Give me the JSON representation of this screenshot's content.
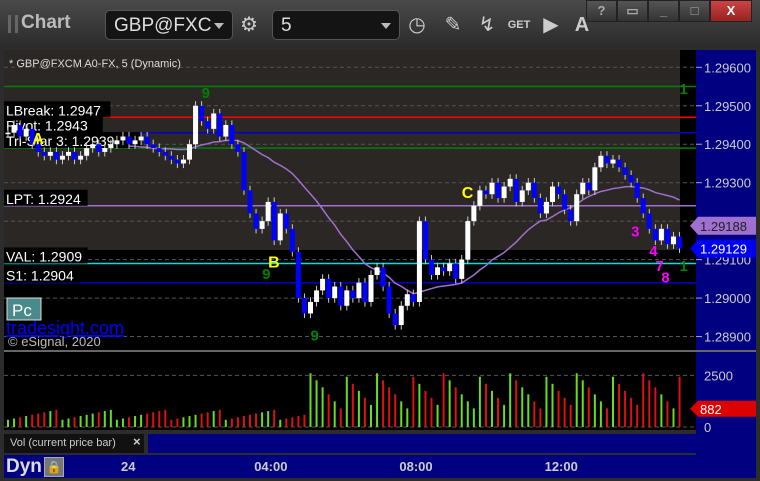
{
  "window": {
    "title": "Chart",
    "symbol": "GBP@FXC",
    "interval": "5",
    "buttons": [
      "?",
      "restore",
      "minimize",
      "maximize",
      "X"
    ]
  },
  "toolbar": {
    "icons": [
      "settings-gear-icon",
      "clock-icon",
      "pencil-icon",
      "study-icon",
      "get-icon",
      "play-icon",
      "alert-icon"
    ],
    "get_label": "GET",
    "alert_label": "A"
  },
  "chart": {
    "header": "* GBP@FXCM A0-FX, 5 (Dynamic)",
    "watermark": "tradesight.com",
    "copyright": "© eSignal, 2020",
    "pc_button": "Pc",
    "price_ticks": [
      "1.29600",
      "1.29500",
      "1.29400",
      "1.29300",
      "1.29200",
      "1.29100",
      "1.29000",
      "1.28900"
    ],
    "price_tick_values": [
      1.296,
      1.295,
      1.294,
      1.293,
      1.292,
      1.291,
      1.29,
      1.289
    ],
    "ylim": [
      1.28865,
      1.29645
    ],
    "ma_marker": "1.29188",
    "last_price": "1.29129",
    "levels": [
      {
        "label": "",
        "value": 1.2955,
        "color": "#008000"
      },
      {
        "label": "LBreak: 1.2947",
        "value": 1.2947,
        "color": "#ff0000"
      },
      {
        "label": "Pivot: 1.2943",
        "value": 1.2943,
        "color": "#0000cc"
      },
      {
        "label": "Tri-Star 3: 1.2939",
        "value": 1.2939,
        "color": "#008000"
      },
      {
        "label": "LPT: 1.2924",
        "value": 1.2924,
        "color": "#a070d0"
      },
      {
        "label": "VAL: 1.2909",
        "value": 1.2909,
        "color": "#00e0e0"
      },
      {
        "label": "S1: 1.2904",
        "value": 1.2904,
        "color": "#0000cc"
      }
    ],
    "annotations": [
      {
        "text": "A",
        "value": 1.294,
        "bar": 4
      },
      {
        "text": "B",
        "value": 1.2908,
        "bar": 43
      },
      {
        "text": "C",
        "value": 1.2926,
        "bar": 75
      }
    ],
    "count_labels": [
      {
        "text": "1",
        "value": 1.2953,
        "bar": 111,
        "color": "#008000"
      },
      {
        "text": "1",
        "value": 1.2907,
        "bar": 111,
        "color": "#008000"
      },
      {
        "text": "9",
        "value": 1.2952,
        "bar": 32,
        "color": "#008000"
      },
      {
        "text": "9",
        "value": 1.2905,
        "bar": 42,
        "color": "#008000"
      },
      {
        "text": "9",
        "value": 1.2889,
        "bar": 50,
        "color": "#008000"
      },
      {
        "text": "3",
        "value": 1.2916,
        "bar": 103,
        "color": "#ff00ff"
      },
      {
        "text": "4",
        "value": 1.2911,
        "bar": 106,
        "color": "#ff00ff"
      },
      {
        "text": "7",
        "value": 1.2907,
        "bar": 107,
        "color": "#ff00ff"
      },
      {
        "text": "8",
        "value": 1.2904,
        "bar": 108,
        "color": "#ff00ff"
      }
    ],
    "closes": [
      1.2943,
      1.2945,
      1.2942,
      1.2944,
      1.294,
      1.2938,
      1.2937,
      1.2938,
      1.2936,
      1.2937,
      1.2938,
      1.2936,
      1.2937,
      1.2939,
      1.294,
      1.2938,
      1.2939,
      1.294,
      1.2941,
      1.2942,
      1.294,
      1.2941,
      1.2942,
      1.294,
      1.2939,
      1.2938,
      1.2937,
      1.2936,
      1.2935,
      1.2936,
      1.294,
      1.295,
      1.2946,
      1.2944,
      1.2948,
      1.2942,
      1.2945,
      1.294,
      1.2938,
      1.2928,
      1.2922,
      1.2918,
      1.292,
      1.2925,
      1.2915,
      1.2922,
      1.2918,
      1.2912,
      1.29,
      1.2896,
      1.2899,
      1.2902,
      1.2905,
      1.29,
      1.2903,
      1.2898,
      1.2902,
      1.29,
      1.2904,
      1.2899,
      1.2906,
      1.2908,
      1.2903,
      1.2896,
      1.2893,
      1.2898,
      1.2901,
      1.2899,
      1.292,
      1.291,
      1.2906,
      1.2908,
      1.2907,
      1.2909,
      1.2905,
      1.291,
      1.292,
      1.2924,
      1.2928,
      1.2927,
      1.293,
      1.2926,
      1.2929,
      1.2931,
      1.2925,
      1.2928,
      1.293,
      1.2926,
      1.2922,
      1.2925,
      1.2929,
      1.2927,
      1.2923,
      1.292,
      1.2927,
      1.293,
      1.2928,
      1.2934,
      1.2937,
      1.2935,
      1.2936,
      1.2934,
      1.2932,
      1.293,
      1.2926,
      1.2922,
      1.2918,
      1.2915,
      1.2918,
      1.2914,
      1.2916,
      1.29129
    ],
    "colors": {
      "up": "#ffffff",
      "down": "#0000ff",
      "ma": "#a070d0",
      "vol_up": "#66dd22",
      "vol_down": "#dd1111",
      "axis_bg": "#000080"
    }
  },
  "volume": {
    "ticks": [
      "2500",
      "0"
    ],
    "tick_values": [
      2500,
      0
    ],
    "ylim": [
      0,
      3000
    ],
    "last": "882",
    "legend": "Vol (current price bar)",
    "close_label": "×"
  },
  "time_axis": {
    "labels": [
      "24",
      "04:00",
      "08:00",
      "12:00"
    ],
    "label_bars": [
      20,
      44,
      68,
      92
    ]
  },
  "bottom": {
    "mode": "Dyn"
  }
}
